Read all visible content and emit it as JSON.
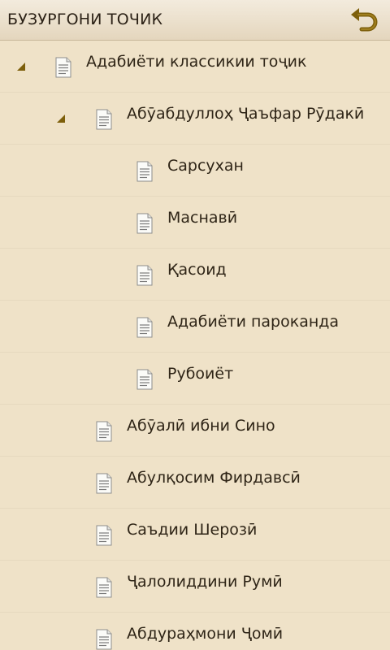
{
  "header": {
    "title": "БУЗУРГОНИ ТОЧИК",
    "back_icon": "back-arrow-icon"
  },
  "colors": {
    "background": "#efe2c8",
    "header_bg": "#eadfcc",
    "accent_icon": "#8a6d0f",
    "text": "#2f2517"
  },
  "tree": [
    {
      "label": "Адабиёти классикии тоҷик",
      "level": 0,
      "expandable": true,
      "expanded": true
    },
    {
      "label": "Абӯабдуллоҳ Ҷаъфар Рӯдакӣ",
      "level": 1,
      "expandable": true,
      "expanded": true
    },
    {
      "label": "Сарсухан",
      "level": 2,
      "expandable": false
    },
    {
      "label": "Маснавӣ",
      "level": 2,
      "expandable": false
    },
    {
      "label": "Қасоид",
      "level": 2,
      "expandable": false
    },
    {
      "label": "Адабиёти пароканда",
      "level": 2,
      "expandable": false
    },
    {
      "label": "Рубоиёт",
      "level": 2,
      "expandable": false
    },
    {
      "label": "Абӯалӣ ибни Сино",
      "level": 1,
      "expandable": false
    },
    {
      "label": "Абулқосим Фирдавсӣ",
      "level": 1,
      "expandable": false
    },
    {
      "label": "Саъдии Шерозӣ",
      "level": 1,
      "expandable": false
    },
    {
      "label": "Ҷалолиддини Румӣ",
      "level": 1,
      "expandable": false
    },
    {
      "label": "Абдураҳмони Ҷомӣ",
      "level": 1,
      "expandable": false
    }
  ]
}
